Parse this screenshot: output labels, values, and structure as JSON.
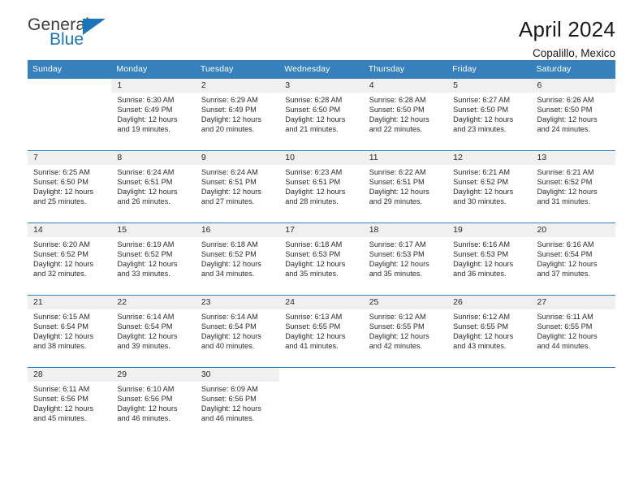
{
  "brand": {
    "name_part1": "General",
    "name_part2": "Blue",
    "flag_icon": "triangle-flag-icon",
    "accent_color": "#1b75bb"
  },
  "header": {
    "title": "April 2024",
    "subtitle": "Copalillo, Mexico"
  },
  "theme": {
    "header_bg": "#3580bd",
    "daynum_bg": "#f0f0f0",
    "text_color": "#2b2b2b"
  },
  "calendar": {
    "weekday_headers": [
      "Sunday",
      "Monday",
      "Tuesday",
      "Wednesday",
      "Thursday",
      "Friday",
      "Saturday"
    ],
    "labels": {
      "sunrise": "Sunrise:",
      "sunset": "Sunset:",
      "daylight": "Daylight:"
    },
    "weeks": [
      [
        {
          "day": "",
          "sunrise": "",
          "sunset": "",
          "daylight_line1": "",
          "daylight_line2": ""
        },
        {
          "day": "1",
          "sunrise": "Sunrise: 6:30 AM",
          "sunset": "Sunset: 6:49 PM",
          "daylight_line1": "Daylight: 12 hours",
          "daylight_line2": "and 19 minutes."
        },
        {
          "day": "2",
          "sunrise": "Sunrise: 6:29 AM",
          "sunset": "Sunset: 6:49 PM",
          "daylight_line1": "Daylight: 12 hours",
          "daylight_line2": "and 20 minutes."
        },
        {
          "day": "3",
          "sunrise": "Sunrise: 6:28 AM",
          "sunset": "Sunset: 6:50 PM",
          "daylight_line1": "Daylight: 12 hours",
          "daylight_line2": "and 21 minutes."
        },
        {
          "day": "4",
          "sunrise": "Sunrise: 6:28 AM",
          "sunset": "Sunset: 6:50 PM",
          "daylight_line1": "Daylight: 12 hours",
          "daylight_line2": "and 22 minutes."
        },
        {
          "day": "5",
          "sunrise": "Sunrise: 6:27 AM",
          "sunset": "Sunset: 6:50 PM",
          "daylight_line1": "Daylight: 12 hours",
          "daylight_line2": "and 23 minutes."
        },
        {
          "day": "6",
          "sunrise": "Sunrise: 6:26 AM",
          "sunset": "Sunset: 6:50 PM",
          "daylight_line1": "Daylight: 12 hours",
          "daylight_line2": "and 24 minutes."
        }
      ],
      [
        {
          "day": "7",
          "sunrise": "Sunrise: 6:25 AM",
          "sunset": "Sunset: 6:50 PM",
          "daylight_line1": "Daylight: 12 hours",
          "daylight_line2": "and 25 minutes."
        },
        {
          "day": "8",
          "sunrise": "Sunrise: 6:24 AM",
          "sunset": "Sunset: 6:51 PM",
          "daylight_line1": "Daylight: 12 hours",
          "daylight_line2": "and 26 minutes."
        },
        {
          "day": "9",
          "sunrise": "Sunrise: 6:24 AM",
          "sunset": "Sunset: 6:51 PM",
          "daylight_line1": "Daylight: 12 hours",
          "daylight_line2": "and 27 minutes."
        },
        {
          "day": "10",
          "sunrise": "Sunrise: 6:23 AM",
          "sunset": "Sunset: 6:51 PM",
          "daylight_line1": "Daylight: 12 hours",
          "daylight_line2": "and 28 minutes."
        },
        {
          "day": "11",
          "sunrise": "Sunrise: 6:22 AM",
          "sunset": "Sunset: 6:51 PM",
          "daylight_line1": "Daylight: 12 hours",
          "daylight_line2": "and 29 minutes."
        },
        {
          "day": "12",
          "sunrise": "Sunrise: 6:21 AM",
          "sunset": "Sunset: 6:52 PM",
          "daylight_line1": "Daylight: 12 hours",
          "daylight_line2": "and 30 minutes."
        },
        {
          "day": "13",
          "sunrise": "Sunrise: 6:21 AM",
          "sunset": "Sunset: 6:52 PM",
          "daylight_line1": "Daylight: 12 hours",
          "daylight_line2": "and 31 minutes."
        }
      ],
      [
        {
          "day": "14",
          "sunrise": "Sunrise: 6:20 AM",
          "sunset": "Sunset: 6:52 PM",
          "daylight_line1": "Daylight: 12 hours",
          "daylight_line2": "and 32 minutes."
        },
        {
          "day": "15",
          "sunrise": "Sunrise: 6:19 AM",
          "sunset": "Sunset: 6:52 PM",
          "daylight_line1": "Daylight: 12 hours",
          "daylight_line2": "and 33 minutes."
        },
        {
          "day": "16",
          "sunrise": "Sunrise: 6:18 AM",
          "sunset": "Sunset: 6:52 PM",
          "daylight_line1": "Daylight: 12 hours",
          "daylight_line2": "and 34 minutes."
        },
        {
          "day": "17",
          "sunrise": "Sunrise: 6:18 AM",
          "sunset": "Sunset: 6:53 PM",
          "daylight_line1": "Daylight: 12 hours",
          "daylight_line2": "and 35 minutes."
        },
        {
          "day": "18",
          "sunrise": "Sunrise: 6:17 AM",
          "sunset": "Sunset: 6:53 PM",
          "daylight_line1": "Daylight: 12 hours",
          "daylight_line2": "and 35 minutes."
        },
        {
          "day": "19",
          "sunrise": "Sunrise: 6:16 AM",
          "sunset": "Sunset: 6:53 PM",
          "daylight_line1": "Daylight: 12 hours",
          "daylight_line2": "and 36 minutes."
        },
        {
          "day": "20",
          "sunrise": "Sunrise: 6:16 AM",
          "sunset": "Sunset: 6:54 PM",
          "daylight_line1": "Daylight: 12 hours",
          "daylight_line2": "and 37 minutes."
        }
      ],
      [
        {
          "day": "21",
          "sunrise": "Sunrise: 6:15 AM",
          "sunset": "Sunset: 6:54 PM",
          "daylight_line1": "Daylight: 12 hours",
          "daylight_line2": "and 38 minutes."
        },
        {
          "day": "22",
          "sunrise": "Sunrise: 6:14 AM",
          "sunset": "Sunset: 6:54 PM",
          "daylight_line1": "Daylight: 12 hours",
          "daylight_line2": "and 39 minutes."
        },
        {
          "day": "23",
          "sunrise": "Sunrise: 6:14 AM",
          "sunset": "Sunset: 6:54 PM",
          "daylight_line1": "Daylight: 12 hours",
          "daylight_line2": "and 40 minutes."
        },
        {
          "day": "24",
          "sunrise": "Sunrise: 6:13 AM",
          "sunset": "Sunset: 6:55 PM",
          "daylight_line1": "Daylight: 12 hours",
          "daylight_line2": "and 41 minutes."
        },
        {
          "day": "25",
          "sunrise": "Sunrise: 6:12 AM",
          "sunset": "Sunset: 6:55 PM",
          "daylight_line1": "Daylight: 12 hours",
          "daylight_line2": "and 42 minutes."
        },
        {
          "day": "26",
          "sunrise": "Sunrise: 6:12 AM",
          "sunset": "Sunset: 6:55 PM",
          "daylight_line1": "Daylight: 12 hours",
          "daylight_line2": "and 43 minutes."
        },
        {
          "day": "27",
          "sunrise": "Sunrise: 6:11 AM",
          "sunset": "Sunset: 6:55 PM",
          "daylight_line1": "Daylight: 12 hours",
          "daylight_line2": "and 44 minutes."
        }
      ],
      [
        {
          "day": "28",
          "sunrise": "Sunrise: 6:11 AM",
          "sunset": "Sunset: 6:56 PM",
          "daylight_line1": "Daylight: 12 hours",
          "daylight_line2": "and 45 minutes."
        },
        {
          "day": "29",
          "sunrise": "Sunrise: 6:10 AM",
          "sunset": "Sunset: 6:56 PM",
          "daylight_line1": "Daylight: 12 hours",
          "daylight_line2": "and 46 minutes."
        },
        {
          "day": "30",
          "sunrise": "Sunrise: 6:09 AM",
          "sunset": "Sunset: 6:56 PM",
          "daylight_line1": "Daylight: 12 hours",
          "daylight_line2": "and 46 minutes."
        },
        {
          "day": "",
          "sunrise": "",
          "sunset": "",
          "daylight_line1": "",
          "daylight_line2": ""
        },
        {
          "day": "",
          "sunrise": "",
          "sunset": "",
          "daylight_line1": "",
          "daylight_line2": ""
        },
        {
          "day": "",
          "sunrise": "",
          "sunset": "",
          "daylight_line1": "",
          "daylight_line2": ""
        },
        {
          "day": "",
          "sunrise": "",
          "sunset": "",
          "daylight_line1": "",
          "daylight_line2": ""
        }
      ]
    ]
  }
}
